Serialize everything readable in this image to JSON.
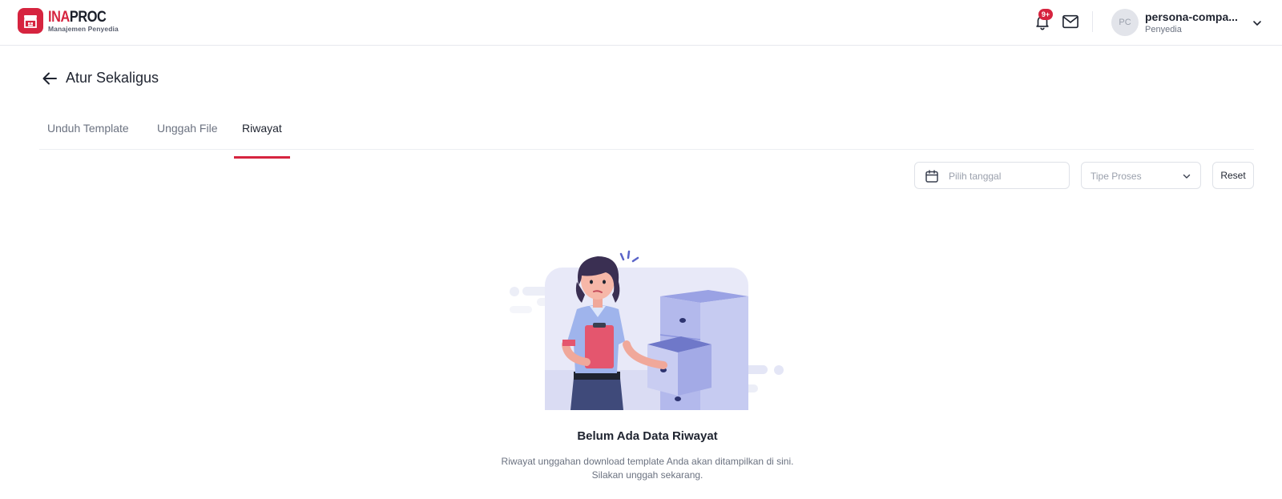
{
  "header": {
    "brand_ina": "INA",
    "brand_proc": "PROC",
    "brand_sub": "Manajemen Penyedia",
    "notification_badge": "9+",
    "avatar_initials": "PC",
    "user_name": "persona-compa...",
    "user_role": "Penyedia"
  },
  "page": {
    "title": "Atur Sekaligus"
  },
  "tabs": [
    {
      "label": "Unduh Template",
      "active": false
    },
    {
      "label": "Unggah File",
      "active": false
    },
    {
      "label": "Riwayat",
      "active": true
    }
  ],
  "filters": {
    "date_placeholder": "Pilih tanggal",
    "process_type_label": "Tipe Proses",
    "reset_label": "Reset"
  },
  "empty_state": {
    "title": "Belum Ada Data Riwayat",
    "line1": "Riwayat unggahan download template Anda akan ditampilkan di sini.",
    "line2": "Silakan unggah sekarang."
  },
  "colors": {
    "brand": "#d6243f",
    "illustration_primary": "#8c95de",
    "illustration_bg": "#e8e9f8"
  }
}
